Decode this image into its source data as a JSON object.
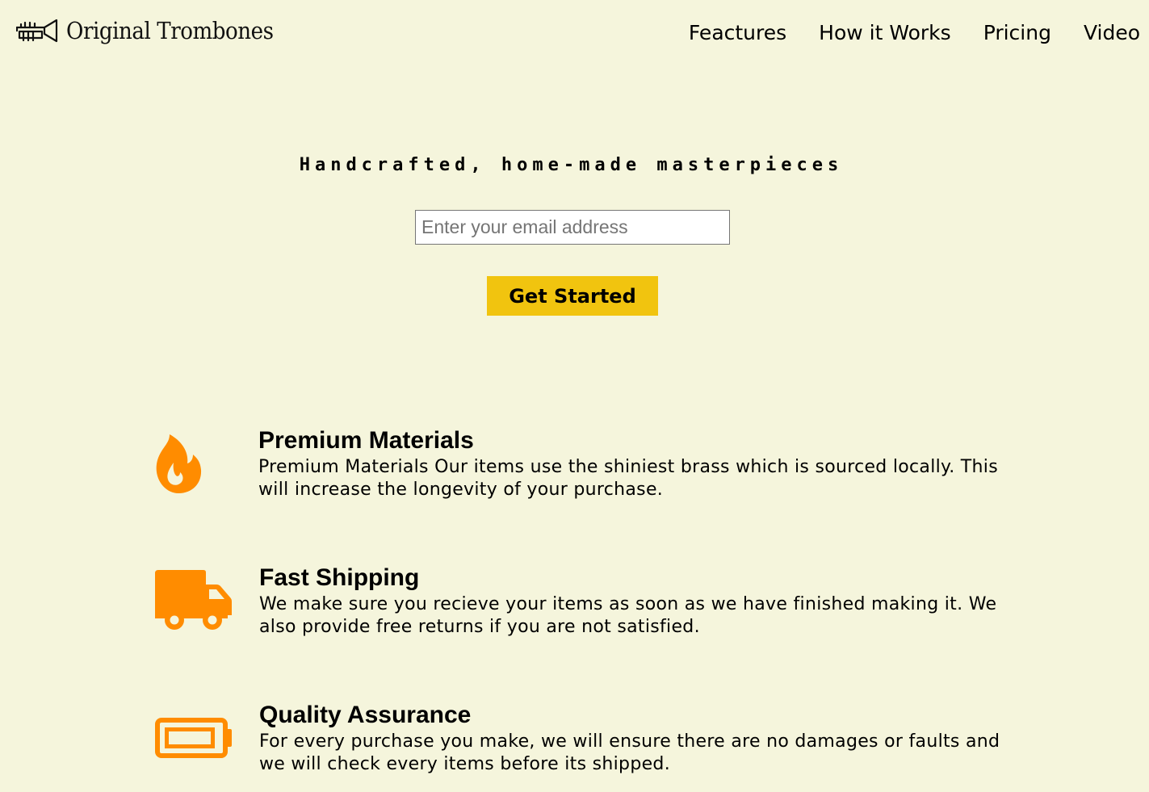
{
  "brand": {
    "name": "Original Trombones",
    "logo_icon": "trumpet-icon"
  },
  "nav": {
    "links": [
      "Feactures",
      "How it Works",
      "Pricing",
      "Video"
    ]
  },
  "hero": {
    "tagline": "Handcrafted, home-made masterpieces",
    "email_placeholder": "Enter your email address",
    "cta_label": "Get Started"
  },
  "features": [
    {
      "icon": "fire-icon",
      "title": "Premium Materials",
      "description": "Premium Materials Our items use the shiniest brass which is sourced locally. This will increase the longevity of your purchase."
    },
    {
      "icon": "truck-icon",
      "title": "Fast Shipping",
      "description": "We make sure you recieve your items as soon as we have finished making it. We also provide free returns if you are not satisfied."
    },
    {
      "icon": "battery-icon",
      "title": "Quality Assurance",
      "description": "For every purchase you make, we will ensure there are no damages or faults and we will check every items before its shipped."
    }
  ],
  "colors": {
    "background": "#f5f5dc",
    "accent_button": "#f1c40f",
    "icon_orange": "#ff8c00"
  }
}
